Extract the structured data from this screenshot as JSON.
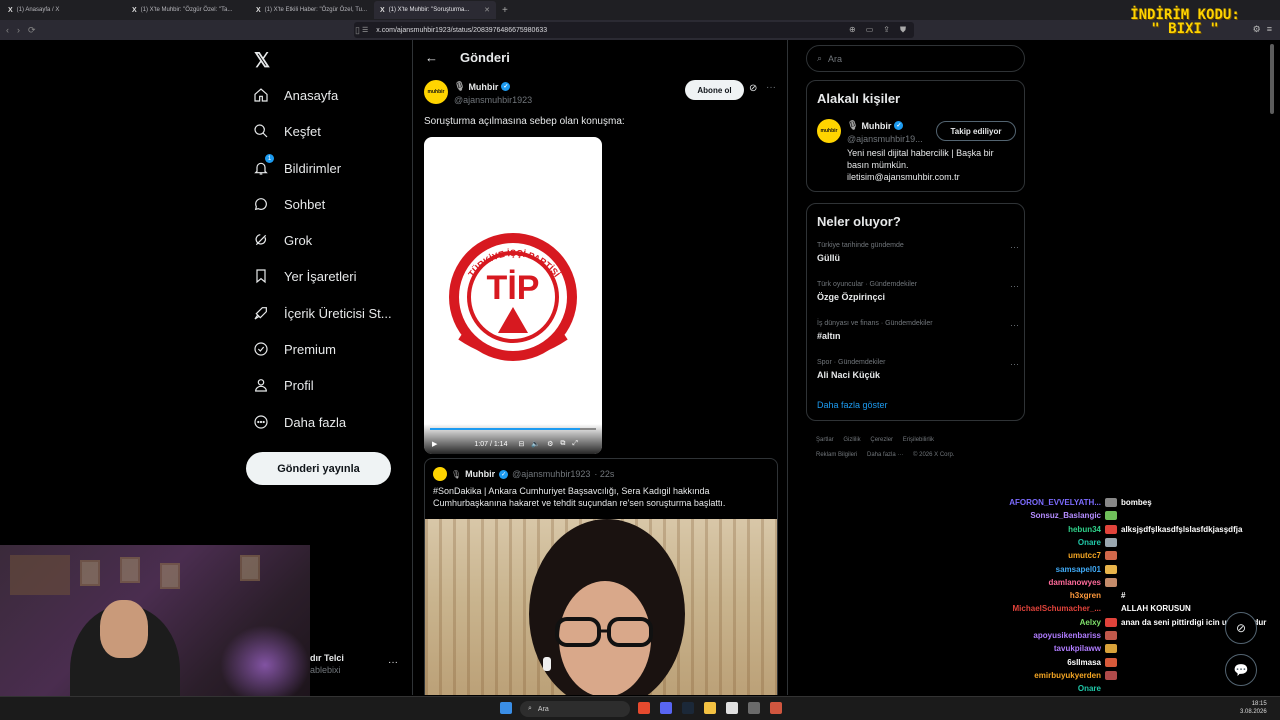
{
  "browser": {
    "tabs": [
      {
        "label": "(1) Anasayfa / X",
        "active": false
      },
      {
        "label": "(1) X'te Muhbir: \"Özgür Özel: \"Ta...",
        "active": false
      },
      {
        "label": "(1) X'te Etkili Haber: \"Özgür Özel, Tu...",
        "active": false
      },
      {
        "label": "(1) X'te Muhbir: \"Soruşturma...",
        "active": true
      }
    ],
    "url": "x.com/ajansmuhbir1923/status/2083976486675980633"
  },
  "promo": {
    "line1": "İNDİRİM KODU:",
    "line2": "\" BIXI \""
  },
  "nav": {
    "items": [
      {
        "label": "Anasayfa",
        "icon": "home-icon"
      },
      {
        "label": "Keşfet",
        "icon": "search-icon"
      },
      {
        "label": "Bildirimler",
        "icon": "bell-icon",
        "badge": "1"
      },
      {
        "label": "Sohbet",
        "icon": "chat-icon"
      },
      {
        "label": "Grok",
        "icon": "grok-icon"
      },
      {
        "label": "Yer İşaretleri",
        "icon": "bookmark-icon"
      },
      {
        "label": "İçerik Üreticisi St...",
        "icon": "rocket-icon"
      },
      {
        "label": "Premium",
        "icon": "premium-icon"
      },
      {
        "label": "Profil",
        "icon": "user-icon"
      },
      {
        "label": "Daha fazla",
        "icon": "more-circle-icon"
      }
    ],
    "post_button": "Gönderi yayınla",
    "account_name": "dır Telci",
    "account_handle": "ablebixi"
  },
  "main": {
    "title": "Gönderi",
    "tweet": {
      "avatar_text": "muhbir",
      "name": "Muhbir",
      "handle": "@ajansmuhbir1923",
      "subscribe": "Abone ol",
      "text": "Soruşturma açılmasına sebep olan konuşma:",
      "video_time": "1:07 / 1:14",
      "video_progress": 0.905,
      "logo_arc": "TÜRKİYE İŞÇİ PARTİSİ",
      "logo_text": "TİP"
    },
    "quote": {
      "name": "Muhbir",
      "handle": "@ajansmuhbir1923",
      "time": "· 22s",
      "text": "#SonDakika | Ankara Cumhuriyet Başsavcılığı, Sera Kadıgil hakkında Cumhurbaşkanına hakaret ve tehdit suçundan re'sen soruşturma başlattı."
    }
  },
  "right": {
    "search_placeholder": "Ara",
    "related_title": "Alakalı kişiler",
    "related": {
      "name": "Muhbir",
      "handle": "@ajansmuhbir19...",
      "follow": "Takip ediliyor",
      "bio": "Yeni nesil dijital habercilik | Başka bir basın mümkün. iletisim@ajansmuhbir.com.tr"
    },
    "trends_title": "Neler oluyor?",
    "trends": [
      {
        "category": "Türkiye tarihinde gündemde",
        "name": "Güllü"
      },
      {
        "category": "Türk oyuncular · Gündemdekiler",
        "name": "Özge Özpirinçci"
      },
      {
        "category": "İş dünyası ve finans · Gündemdekiler",
        "name": "#altın"
      },
      {
        "category": "Spor · Gündemdekiler",
        "name": "Ali Naci Küçük"
      }
    ],
    "show_more": "Daha fazla göster",
    "footer": [
      "Şartlar",
      "Gizlilik",
      "Çerezler",
      "Erişilebilirlik",
      "Reklam Bilgileri",
      "Daha fazla ···",
      "© 2026 X Corp."
    ]
  },
  "chat": [
    {
      "user": "AFORON_EVVELYATH...",
      "color": "#7c6bff",
      "msg": "bombeş",
      "emote": "#888888"
    },
    {
      "user": "Sonsuz_Baslangic",
      "color": "#b48cff",
      "msg": "",
      "emote": "#6fbf5a"
    },
    {
      "user": "hebun34",
      "color": "#2fd18a",
      "msg": "alksjşdfşlkasdfşlslasfdkjasşdfja",
      "emote": "#e0433b"
    },
    {
      "user": "Onare",
      "color": "#20c7a8",
      "msg": "",
      "emote": "#9aa7b0"
    },
    {
      "user": "umutcc7",
      "color": "#f5a623",
      "msg": "",
      "emote": "#d0674a"
    },
    {
      "user": "samsapel01",
      "color": "#3fa9f5",
      "msg": "",
      "emote": "#e8b44a"
    },
    {
      "user": "damlanowyes",
      "color": "#ff6b9a",
      "msg": "",
      "emote": "#c48b6a"
    },
    {
      "user": "h3xgren",
      "color": "#ff9a3c",
      "msg": "#",
      "emote": "#000000"
    },
    {
      "user": "MichaelSchumacher_...",
      "color": "#e0433b",
      "msg": "ALLAH KORUSUN",
      "emote": "#000000"
    },
    {
      "user": "Aelxy",
      "color": "#7fe06b",
      "msg": "anan da seni pittirdigi icin utanıyordur",
      "emote": "#e0433b"
    },
    {
      "user": "apoyusikenbariss",
      "color": "#b07cff",
      "msg": "",
      "emote": "#c0584a"
    },
    {
      "user": "tavukpilaww",
      "color": "#b07cff",
      "msg": "",
      "emote": "#d8a23a"
    },
    {
      "user": "6sllmasa",
      "color": "#ffffff",
      "msg": "",
      "emote": "#d85a3a"
    },
    {
      "user": "emirbuyukyerden",
      "color": "#f5a623",
      "msg": "",
      "emote": "#b04a4a"
    },
    {
      "user": "Onare",
      "color": "#20c7a8",
      "msg": "",
      "emote": "#000000"
    }
  ],
  "taskbar": {
    "search": "Ara",
    "time": "18:15",
    "date": "3.08.2026"
  }
}
